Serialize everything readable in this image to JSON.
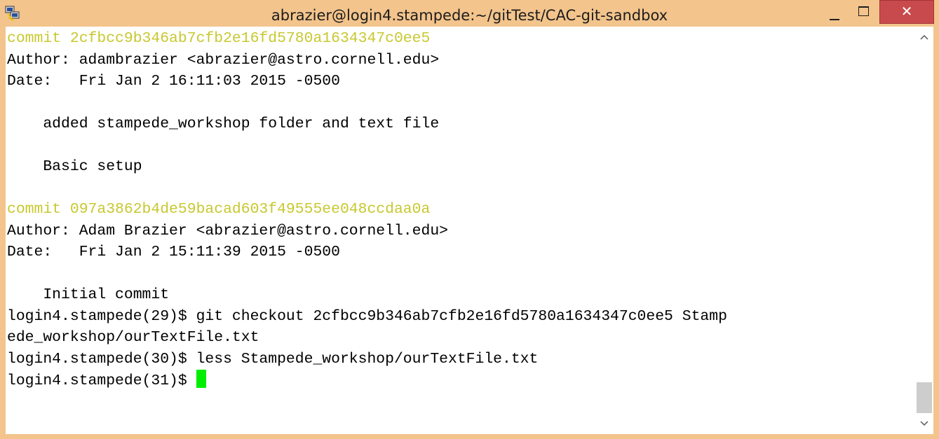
{
  "window": {
    "title": "abrazier@login4.stampede:~/gitTest/CAC-git-sandbox",
    "close_glyph": "✕",
    "accent_color": "#f3c48c",
    "close_color": "#c94a4d",
    "icons": [
      "putty-icon",
      "minimize-icon",
      "maximize-icon",
      "close-icon"
    ]
  },
  "terminal": {
    "commit_color": "#c8c830",
    "cursor_color": "#00ee00",
    "lines": [
      {
        "text": "commit 2cfbcc9b346ab7cfb2e16fd5780a1634347c0ee5",
        "kind": "commit"
      },
      {
        "text": "Author: adambrazier <abrazier@astro.cornell.edu>",
        "kind": "normal"
      },
      {
        "text": "Date:   Fri Jan 2 16:11:03 2015 -0500",
        "kind": "normal"
      },
      {
        "text": "",
        "kind": "normal"
      },
      {
        "text": "    added stampede_workshop folder and text file",
        "kind": "normal"
      },
      {
        "text": "",
        "kind": "normal"
      },
      {
        "text": "    Basic setup",
        "kind": "normal"
      },
      {
        "text": "",
        "kind": "normal"
      },
      {
        "text": "commit 097a3862b4de59bacad603f49555ee048ccdaa0a",
        "kind": "commit"
      },
      {
        "text": "Author: Adam Brazier <abrazier@astro.cornell.edu>",
        "kind": "normal"
      },
      {
        "text": "Date:   Fri Jan 2 15:11:39 2015 -0500",
        "kind": "normal"
      },
      {
        "text": "",
        "kind": "normal"
      },
      {
        "text": "    Initial commit",
        "kind": "normal"
      },
      {
        "text": "login4.stampede(29)$ git checkout 2cfbcc9b346ab7cfb2e16fd5780a1634347c0ee5 Stamp",
        "kind": "normal"
      },
      {
        "text": "ede_workshop/ourTextFile.txt",
        "kind": "normal"
      },
      {
        "text": "login4.stampede(30)$ less Stampede_workshop/ourTextFile.txt",
        "kind": "normal"
      },
      {
        "text": "login4.stampede(31)$ ",
        "kind": "prompt"
      }
    ]
  }
}
